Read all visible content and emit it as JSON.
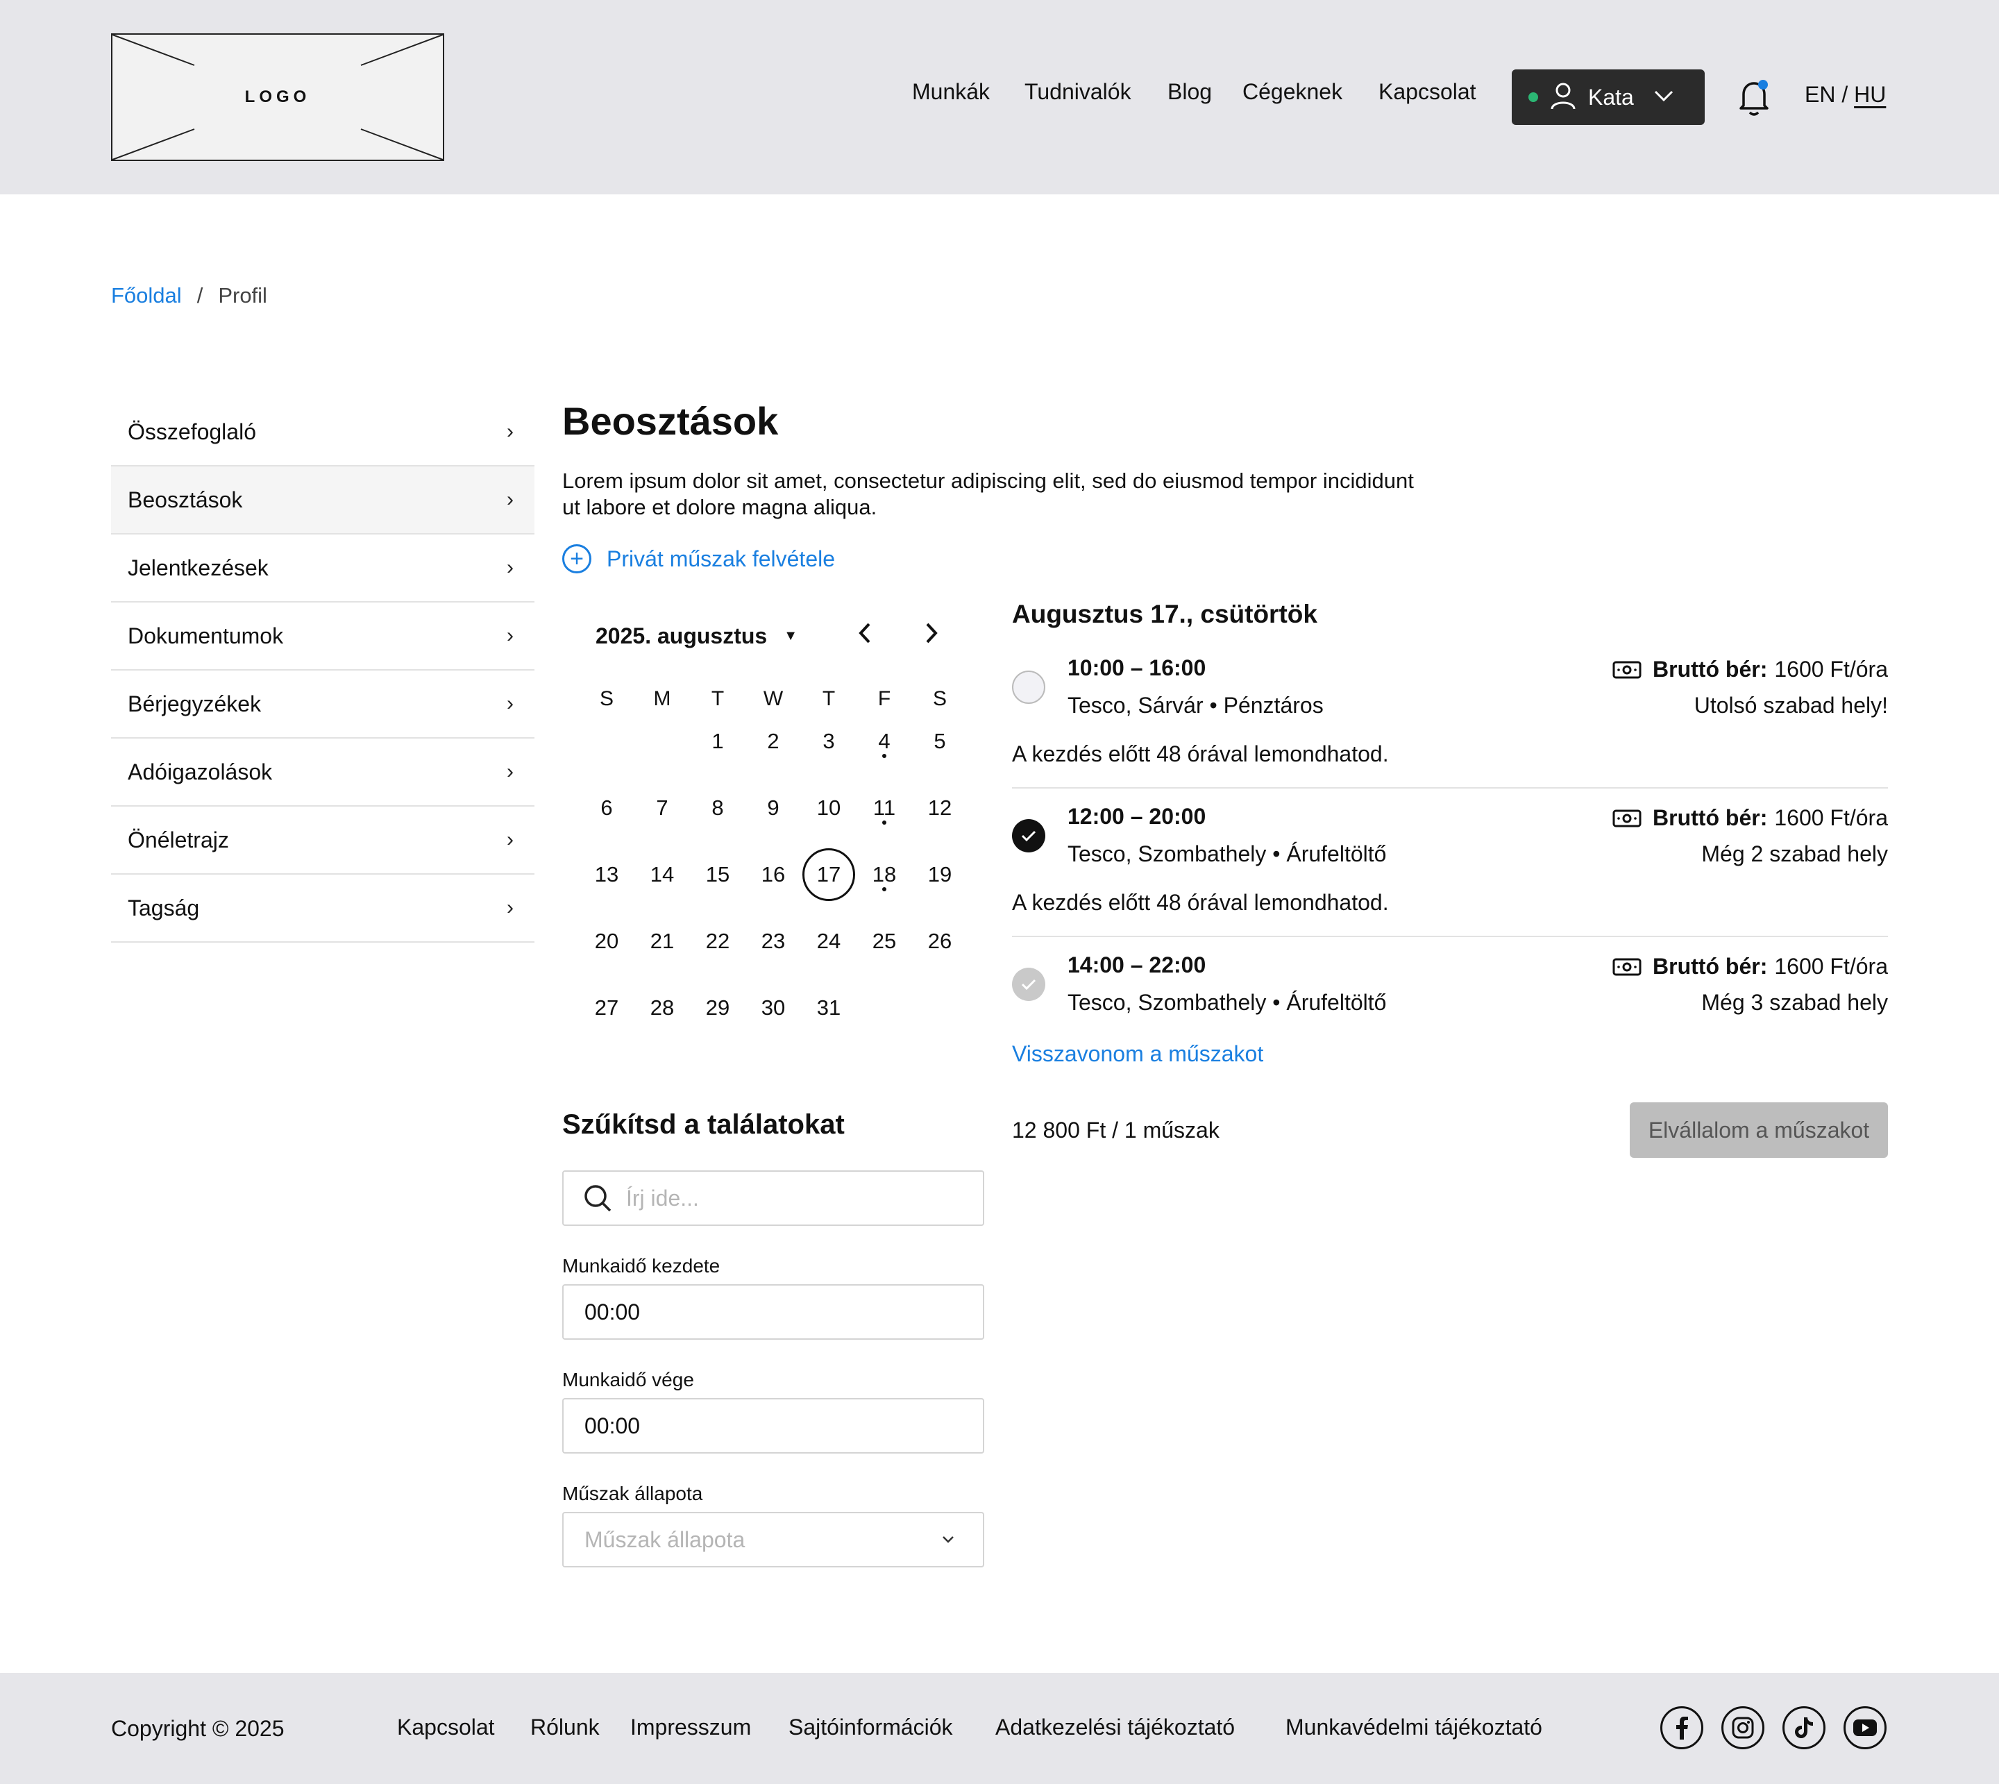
{
  "header": {
    "logo_text": "LOGO",
    "nav": [
      "Munkák",
      "Tudnivalók",
      "Blog",
      "Cégeknek",
      "Kapcsolat"
    ],
    "user_name": "Kata",
    "lang_en": "EN",
    "lang_sep": "/",
    "lang_hu": "HU"
  },
  "breadcrumb": {
    "home": "Főoldal",
    "sep": "/",
    "current": "Profil"
  },
  "sidebar": {
    "items": [
      {
        "label": "Összefoglaló"
      },
      {
        "label": "Beosztások"
      },
      {
        "label": "Jelentkezések"
      },
      {
        "label": "Dokumentumok"
      },
      {
        "label": "Bérjegyzékek"
      },
      {
        "label": "Adóigazolások"
      },
      {
        "label": "Önéletrajz"
      },
      {
        "label": "Tagság"
      }
    ]
  },
  "main": {
    "title": "Beosztások",
    "description": "Lorem ipsum dolor sit amet, consectetur adipiscing elit, sed do eiusmod tempor incididunt ut labore et dolore magna aliqua.",
    "add_shift": "Privát műszak felvétele"
  },
  "calendar": {
    "month_label": "2025. augusztus",
    "weekdays": [
      "S",
      "M",
      "T",
      "W",
      "T",
      "F",
      "S"
    ],
    "selected_day": "17",
    "weeks": [
      [
        "",
        "",
        "1",
        "2",
        "3",
        "4",
        "5"
      ],
      [
        "6",
        "7",
        "8",
        "9",
        "10",
        "11",
        "12"
      ],
      [
        "13",
        "14",
        "15",
        "16",
        "17",
        "18",
        "19"
      ],
      [
        "20",
        "21",
        "22",
        "23",
        "24",
        "25",
        "26"
      ],
      [
        "27",
        "28",
        "29",
        "30",
        "31",
        "",
        ""
      ]
    ],
    "event_days": [
      "4",
      "11",
      "18"
    ]
  },
  "filters": {
    "title": "Szűkítsd a találatokat",
    "search_placeholder": "Írj ide...",
    "start_label": "Munkaidő kezdete",
    "start_value": "00:00",
    "end_label": "Munkaidő vége",
    "end_value": "00:00",
    "status_label": "Műszak állapota",
    "status_placeholder": "Műszak állapota"
  },
  "day": {
    "title": "Augusztus 17., csütörtök",
    "shifts": [
      {
        "time": "10:00 – 16:00",
        "location": "Tesco, Sárvár • Pénztáros",
        "pay_label": "Bruttó bér:",
        "pay_value": "1600 Ft/óra",
        "availability": "Utolsó szabad hely!",
        "cancel_note": "A kezdés előtt 48 órával lemondhatod.",
        "state": "empty"
      },
      {
        "time": "12:00 – 20:00",
        "location": "Tesco, Szombathely • Árufeltöltő",
        "pay_label": "Bruttó bér:",
        "pay_value": "1600 Ft/óra",
        "availability": "Még 2 szabad hely",
        "cancel_note": "A kezdés előtt 48 órával lemondhatod.",
        "state": "checked"
      },
      {
        "time": "14:00 – 22:00",
        "location": "Tesco, Szombathely • Árufeltöltő",
        "pay_label": "Bruttó bér:",
        "pay_value": "1600 Ft/óra",
        "availability": "Még 3 szabad hely",
        "state": "disabled"
      }
    ],
    "withdraw": "Visszavonom a műszakot",
    "total": "12 800 Ft / 1 műszak",
    "accept": "Elvállalom a műszakot"
  },
  "footer": {
    "copyright": "Copyright © 2025",
    "links": [
      "Kapcsolat",
      "Rólunk",
      "Impresszum",
      "Sajtóinformációk",
      "Adatkezelési tájékoztató",
      "Munkavédelmi tájékoztató"
    ],
    "social": [
      "facebook-icon",
      "instagram-icon",
      "tiktok-icon",
      "youtube-icon"
    ]
  },
  "colors": {
    "accent": "#1a7fe0",
    "online": "#2bb673",
    "header_bg": "#e6e6ea"
  }
}
